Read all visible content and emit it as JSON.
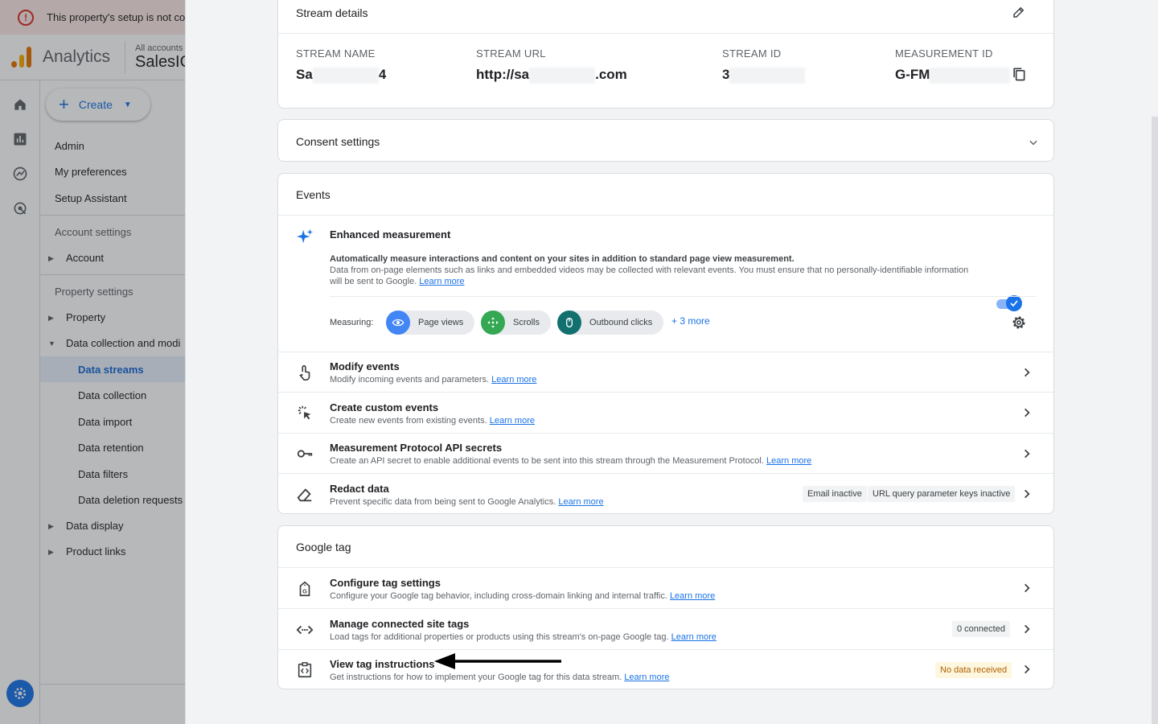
{
  "background": {
    "banner_text": "This property's setup is not co",
    "app_name": "Analytics",
    "account_small": "All accounts",
    "account_big": "SalesIQ",
    "create_label": "Create",
    "nav": {
      "admin": "Admin",
      "my_preferences": "My preferences",
      "setup_assistant": "Setup Assistant",
      "account_settings_header": "Account settings",
      "account": "Account",
      "property_settings_header": "Property settings",
      "property": "Property",
      "data_collection_and_modification": "Data collection and modi",
      "data_streams": "Data streams",
      "data_collection": "Data collection",
      "data_import": "Data import",
      "data_retention": "Data retention",
      "data_filters": "Data filters",
      "data_deletion_requests": "Data deletion requests",
      "data_display": "Data display",
      "product_links": "Product links"
    }
  },
  "stream_details": {
    "title": "Stream details",
    "fields": [
      {
        "label": "STREAM NAME",
        "value_start": "Sa",
        "value_end": "4"
      },
      {
        "label": "STREAM URL",
        "value_start": "http://sa",
        "value_end": ".com"
      },
      {
        "label": "STREAM ID",
        "value_start": "3",
        "value_end": ""
      },
      {
        "label": "MEASUREMENT ID",
        "value_start": "G-FM",
        "value_end": ""
      }
    ]
  },
  "consent": {
    "title": "Consent settings"
  },
  "events": {
    "title": "Events",
    "enhanced": {
      "title": "Enhanced measurement",
      "desc_bold": "Automatically measure interactions and content on your sites in addition to standard page view measurement.",
      "desc": "Data from on-page elements such as links and embedded videos may be collected with relevant events. You must ensure that no personally-identifiable information",
      "desc_end": "will be sent to Google.",
      "learn_more": "Learn more",
      "toggle_on": true,
      "measuring_label": "Measuring:",
      "chips": [
        "Page views",
        "Scrolls",
        "Outbound clicks"
      ],
      "more": "+ 3 more"
    },
    "rows": [
      {
        "title": "Modify events",
        "sub": "Modify incoming events and parameters.",
        "link": "Learn more"
      },
      {
        "title": "Create custom events",
        "sub": "Create new events from existing events.",
        "link": "Learn more"
      },
      {
        "title": "Measurement Protocol API secrets",
        "sub": "Create an API secret to enable additional events to be sent into this stream through the Measurement Protocol.",
        "link": "Learn more"
      },
      {
        "title": "Redact data",
        "sub": "Prevent specific data from being sent to Google Analytics.",
        "link": "Learn more",
        "chips": [
          "Email inactive",
          "URL query parameter keys inactive"
        ]
      }
    ]
  },
  "google_tag": {
    "title": "Google tag",
    "rows": [
      {
        "title": "Configure tag settings",
        "sub": "Configure your Google tag behavior, including cross-domain linking and internal traffic.",
        "link": "Learn more"
      },
      {
        "title": "Manage connected site tags",
        "sub": "Load tags for additional properties or products using this stream's on-page Google tag.",
        "link": "Learn more",
        "chip": "0 connected"
      },
      {
        "title": "View tag instructions",
        "sub": "Get instructions for how to implement your Google tag for this data stream.",
        "link": "Learn more",
        "chip": "No data received"
      }
    ]
  },
  "colors": {
    "accent": "#1a73e8",
    "warning_bg": "#fef7e0",
    "warning_text": "#b06000",
    "scrim": "#202124"
  }
}
